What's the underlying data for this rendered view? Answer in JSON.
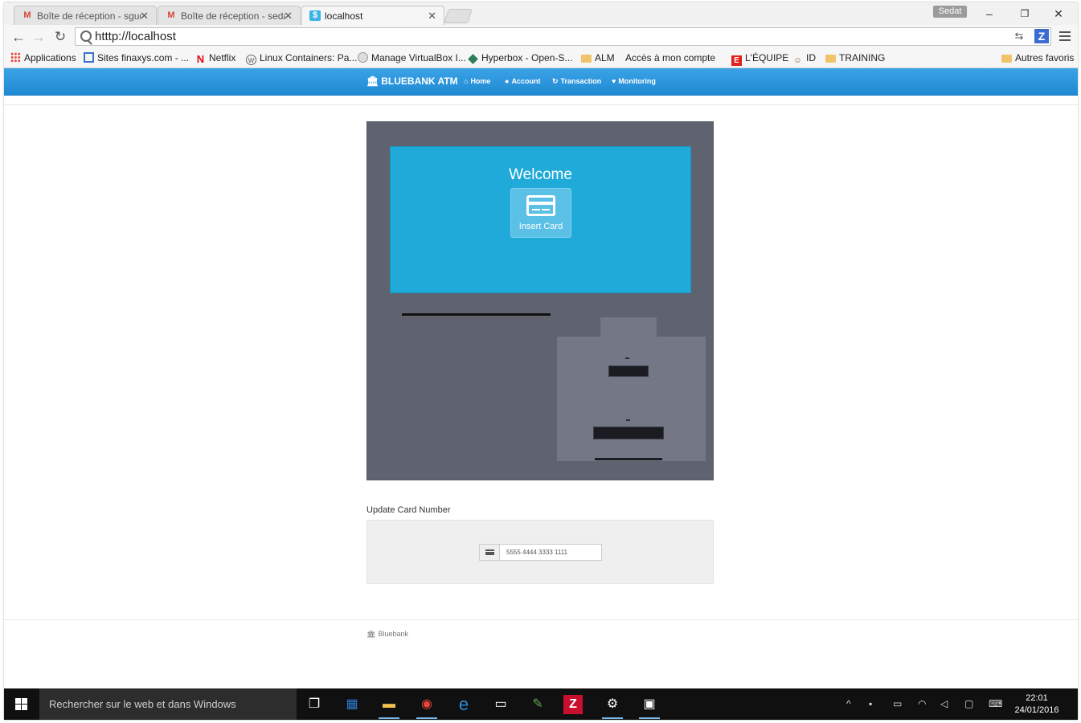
{
  "browser": {
    "tabs": [
      {
        "title": "Boîte de réception - sguc",
        "icon": "gmail-icon"
      },
      {
        "title": "Boîte de réception - sedat",
        "icon": "gmail-icon"
      },
      {
        "title": "localhost",
        "icon": "dollar-icon",
        "active": true
      }
    ],
    "user_badge": "Sedat",
    "url": "htttp://localhost",
    "bookmarks": [
      {
        "label": "Applications",
        "icon": "apps-grid-icon"
      },
      {
        "label": "Sites finaxys.com - ...",
        "icon": "sites-icon"
      },
      {
        "label": "Netflix",
        "icon": "netflix-icon"
      },
      {
        "label": "Linux Containers: Pa...",
        "icon": "wordpress-icon"
      },
      {
        "label": "Manage VirtualBox I...",
        "icon": "virtualbox-icon"
      },
      {
        "label": "Hyperbox - Open-S...",
        "icon": "hyperbox-icon"
      },
      {
        "label": "ALM",
        "icon": "folder-icon"
      },
      {
        "label": "Accès à mon compte",
        "icon": "page-icon"
      },
      {
        "label": "L'ÉQUIPE",
        "icon": "lequipe-icon"
      },
      {
        "label": "ID",
        "icon": "id-icon"
      },
      {
        "label": "TRAINING",
        "icon": "folder-icon"
      }
    ],
    "other_bookmarks": "Autres favoris"
  },
  "navbar": {
    "brand": "BLUEBANK ATM",
    "links": [
      "Home",
      "Account",
      "Transaction",
      "Monitoring"
    ]
  },
  "atm": {
    "welcome": "Welcome",
    "insert_card": "Insert Card"
  },
  "update_card": {
    "label": "Update Card Number",
    "value": "5555 4444 3333 1111"
  },
  "footer": {
    "brand": "Bluebank"
  },
  "taskbar": {
    "search_placeholder": "Rechercher sur le web et dans Windows",
    "time": "22:01",
    "date": "24/01/2016"
  },
  "colors": {
    "navbar": "#1f8ad3",
    "atm_body": "#5f636f",
    "atm_screen": "#1faad9"
  }
}
